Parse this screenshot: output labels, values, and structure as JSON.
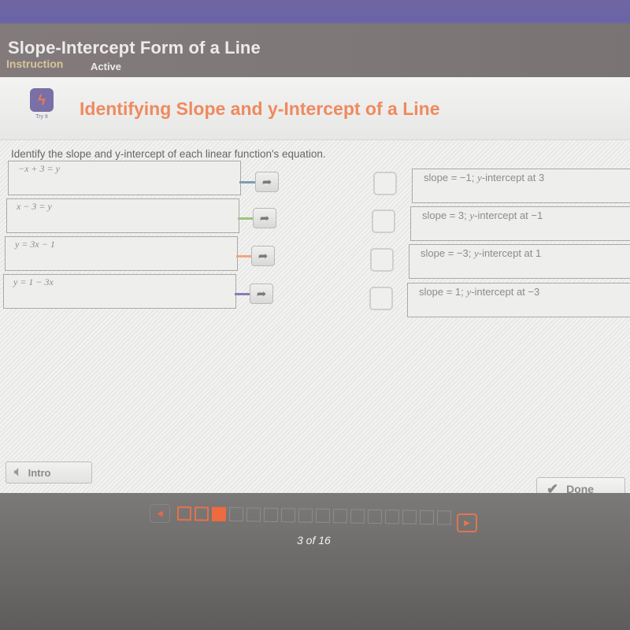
{
  "header": {
    "title": "Slope-Intercept Form of a Line",
    "tabs": [
      {
        "label": "Instruction",
        "state": "selected"
      },
      {
        "label": "Active",
        "state": "normal"
      }
    ]
  },
  "activity": {
    "icon": "try-it-lightning-icon",
    "icon_label": "Try It",
    "title": "Identifying Slope and y-Intercept of a Line",
    "instructions": "Identify the slope and y-intercept of each linear function's equation."
  },
  "equations": [
    {
      "text": "−x + 3 = y",
      "connector_color": "#7c9eb5"
    },
    {
      "text": "x − 3 = y",
      "connector_color": "#9cc47e"
    },
    {
      "text": "y = 3x − 1",
      "connector_color": "#f2a77f"
    },
    {
      "text": "y = 1 − 3x",
      "connector_color": "#8f7ab3"
    }
  ],
  "answers": [
    {
      "text": "slope = −1; y-intercept at 3"
    },
    {
      "text": "slope = 3; y-intercept at −1"
    },
    {
      "text": "slope = −3; y-intercept at 1"
    },
    {
      "text": "slope = 1; y-intercept at −3"
    }
  ],
  "buttons": {
    "intro": "Intro",
    "done": "Done"
  },
  "navigation": {
    "current_page": 3,
    "total_pages": 16,
    "page_label": "3 of 16",
    "visited_pages": [
      1,
      2
    ],
    "accent": "#ee6a3f"
  }
}
